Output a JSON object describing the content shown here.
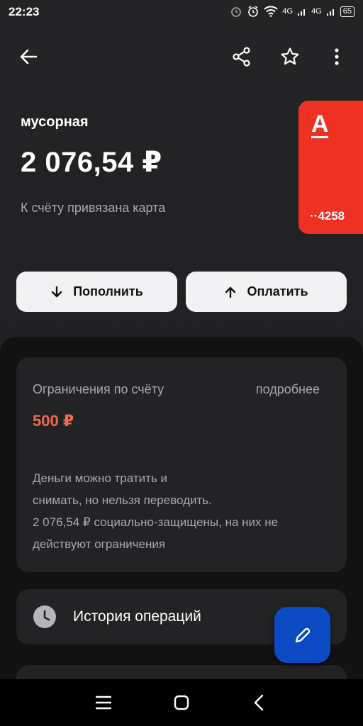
{
  "status_bar": {
    "time": "22:23",
    "network_1": "4G",
    "network_2": "4G",
    "battery": "65"
  },
  "toolbar": {
    "icons": [
      "back-arrow-icon",
      "share-icon",
      "star-icon",
      "more-vert-icon"
    ]
  },
  "account": {
    "name": "мусорная",
    "balance": "2 076,54 ₽",
    "note": "К счёту привязана карта"
  },
  "card": {
    "logo": "А",
    "number": "··4258",
    "color": "#ef3124"
  },
  "actions": {
    "topup_label": "Пополнить",
    "pay_label": "Оплатить"
  },
  "limits": {
    "title": "Ограничения по счёту",
    "more_label": "подробнее",
    "amount": "500 ₽",
    "amount_color": "#f06a52",
    "description_lines": [
      "Деньги можно тратить и",
      "снимать, но нельзя переводить.",
      "2 076,54 ₽ социально-защищены, на них не",
      "действуют ограничения"
    ]
  },
  "history": {
    "label": "История операций"
  },
  "fab": {
    "icon": "pencil-icon",
    "color": "#0b4ac2"
  },
  "nav": {
    "icons": [
      "menu-icon",
      "home-icon",
      "back-icon"
    ]
  }
}
